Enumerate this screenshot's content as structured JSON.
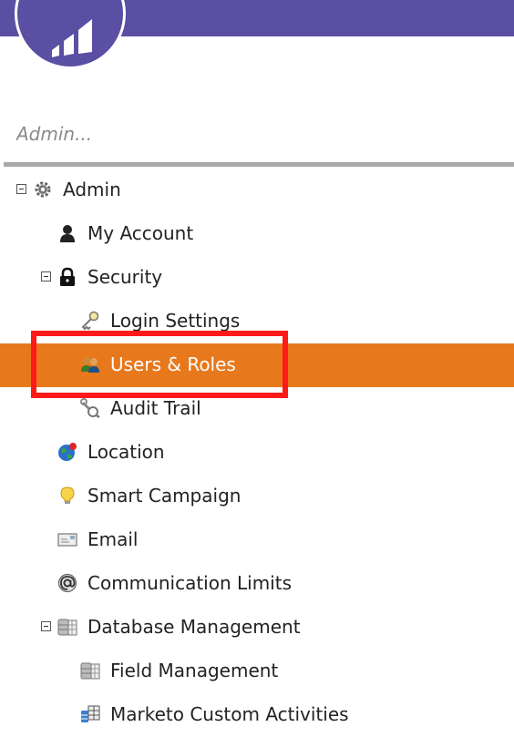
{
  "search": {
    "placeholder": "Admin..."
  },
  "tree": {
    "admin": "Admin",
    "my_account": "My Account",
    "security": "Security",
    "login_settings": "Login Settings",
    "users_roles": "Users & Roles",
    "audit_trail": "Audit Trail",
    "location": "Location",
    "smart_campaign": "Smart Campaign",
    "email": "Email",
    "communication_limits": "Communication Limits",
    "database_management": "Database Management",
    "field_management": "Field Management",
    "marketo_custom_activities": "Marketo Custom Activities"
  },
  "colors": {
    "header": "#5a4fa3",
    "selected": "#e8781c",
    "highlight": "#ff1a1a"
  }
}
